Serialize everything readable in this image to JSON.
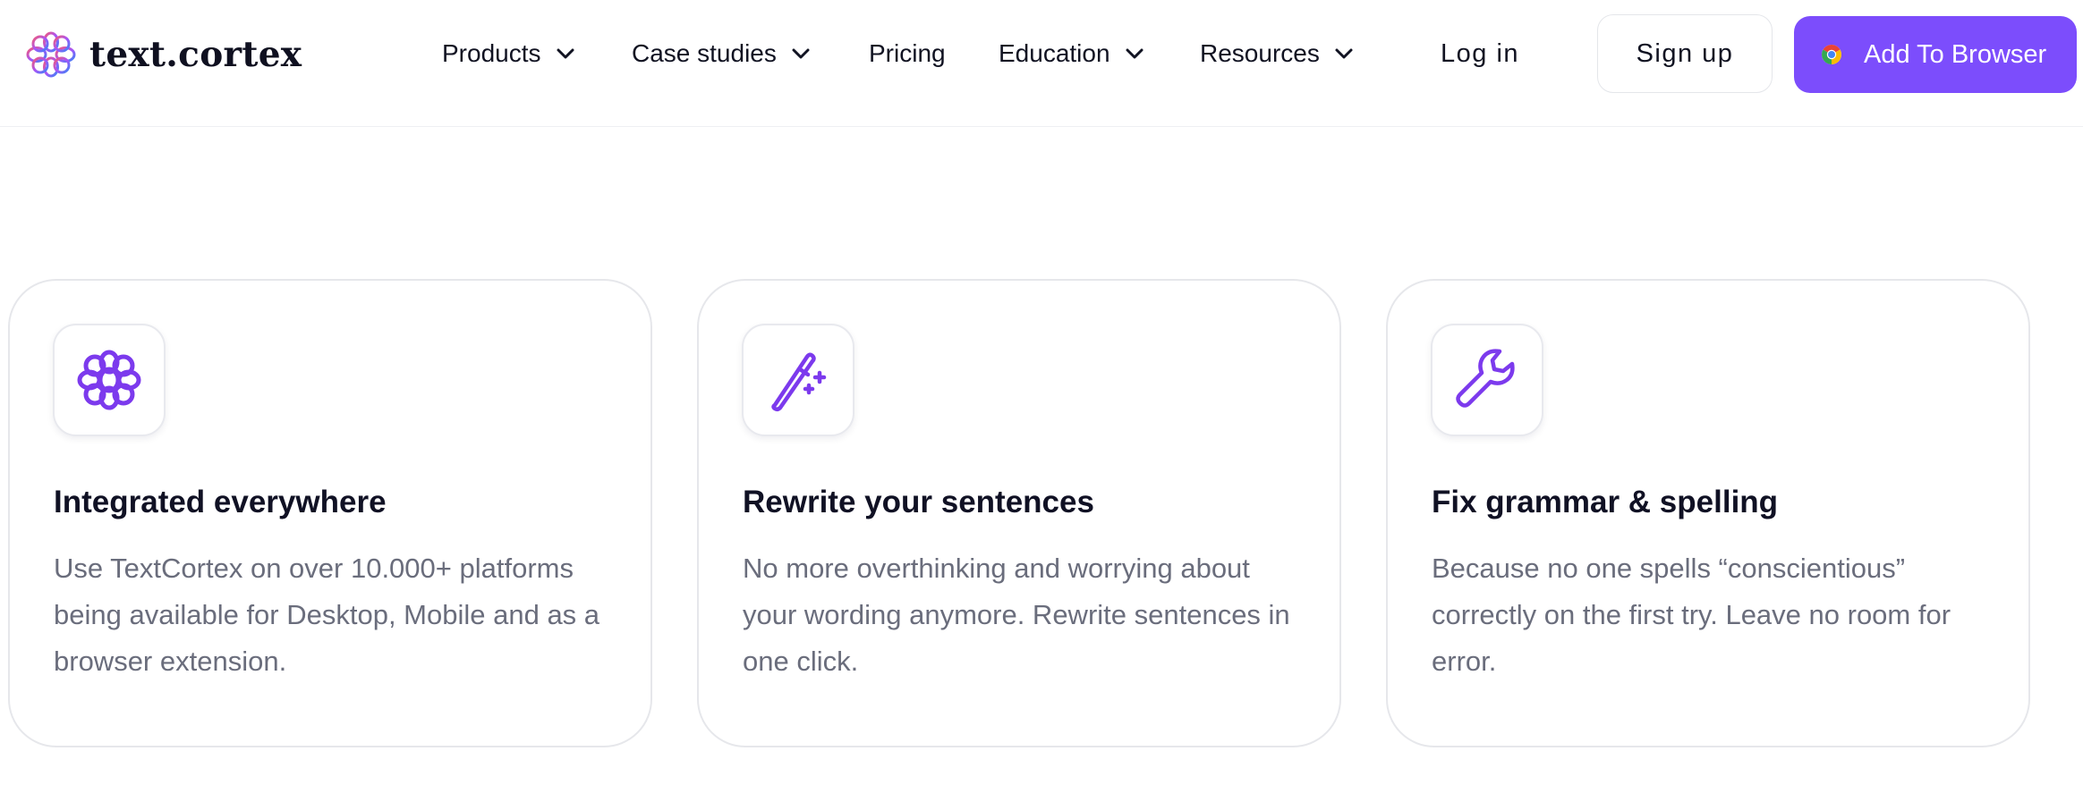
{
  "header": {
    "logo_text": "text.cortex",
    "nav": [
      {
        "label": "Products",
        "has_dropdown": true
      },
      {
        "label": "Case studies",
        "has_dropdown": true
      },
      {
        "label": "Pricing",
        "has_dropdown": false
      },
      {
        "label": "Education",
        "has_dropdown": true
      },
      {
        "label": "Resources",
        "has_dropdown": true
      }
    ],
    "login_label": "Log in",
    "signup_label": "Sign up",
    "add_browser_label": "Add To Browser",
    "add_browser_icon": "chrome-icon"
  },
  "cards": [
    {
      "icon": "flower-logo-icon",
      "title": "Integrated everywhere",
      "description": "Use TextCortex on over 10.000+ platforms being available for Desktop, Mobile and as a browser extension."
    },
    {
      "icon": "magic-wand-icon",
      "title": "Rewrite your sentences",
      "description": "No more overthinking and worrying about your wording anymore. Rewrite sentences in one click."
    },
    {
      "icon": "wrench-icon",
      "title": "Fix grammar & spelling",
      "description": "Because no one spells “conscientious” correctly on the first try. Leave no room for error."
    }
  ],
  "colors": {
    "accent": "#7c4dfc",
    "text_primary": "#101124",
    "text_secondary": "#6a6d7c",
    "border": "#e6e7eb"
  }
}
